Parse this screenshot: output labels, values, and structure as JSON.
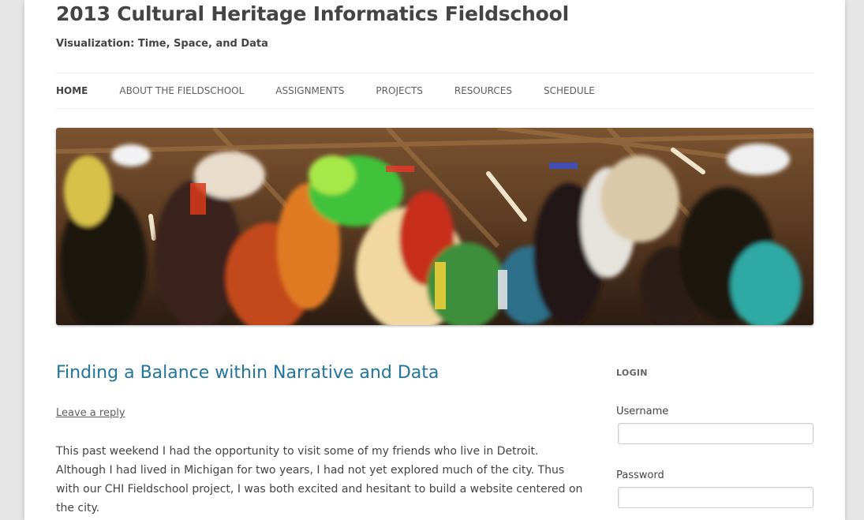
{
  "site": {
    "title": "2013 Cultural Heritage Informatics Fieldschool",
    "description": "Visualization: Time, Space, and Data"
  },
  "nav": {
    "items": [
      {
        "label": "HOME",
        "current": true
      },
      {
        "label": "ABOUT THE FIELDSCHOOL",
        "current": false
      },
      {
        "label": "ASSIGNMENTS",
        "current": false
      },
      {
        "label": "PROJECTS",
        "current": false
      },
      {
        "label": "RESOURCES",
        "current": false
      },
      {
        "label": "SCHEDULE",
        "current": false
      }
    ]
  },
  "post": {
    "title": "Finding a Balance within Narrative and Data",
    "reply_link": "Leave a reply",
    "lines": [
      "This past weekend I had the opportunity to visit some of my friends who live in Detroit.",
      "Although I had lived in Michigan for two years, I had not yet explored much of the city. Thus",
      "with our CHI Fieldschool project, I was both excited and hesitant to build a website centered on",
      "the city."
    ]
  },
  "sidebar": {
    "login": {
      "title": "LOGIN",
      "username_label": "Username",
      "username_value": "",
      "password_label": "Password",
      "password_value": ""
    }
  },
  "colors": {
    "link": "#21759b",
    "text": "#444444",
    "background": "#e6e6e6"
  }
}
